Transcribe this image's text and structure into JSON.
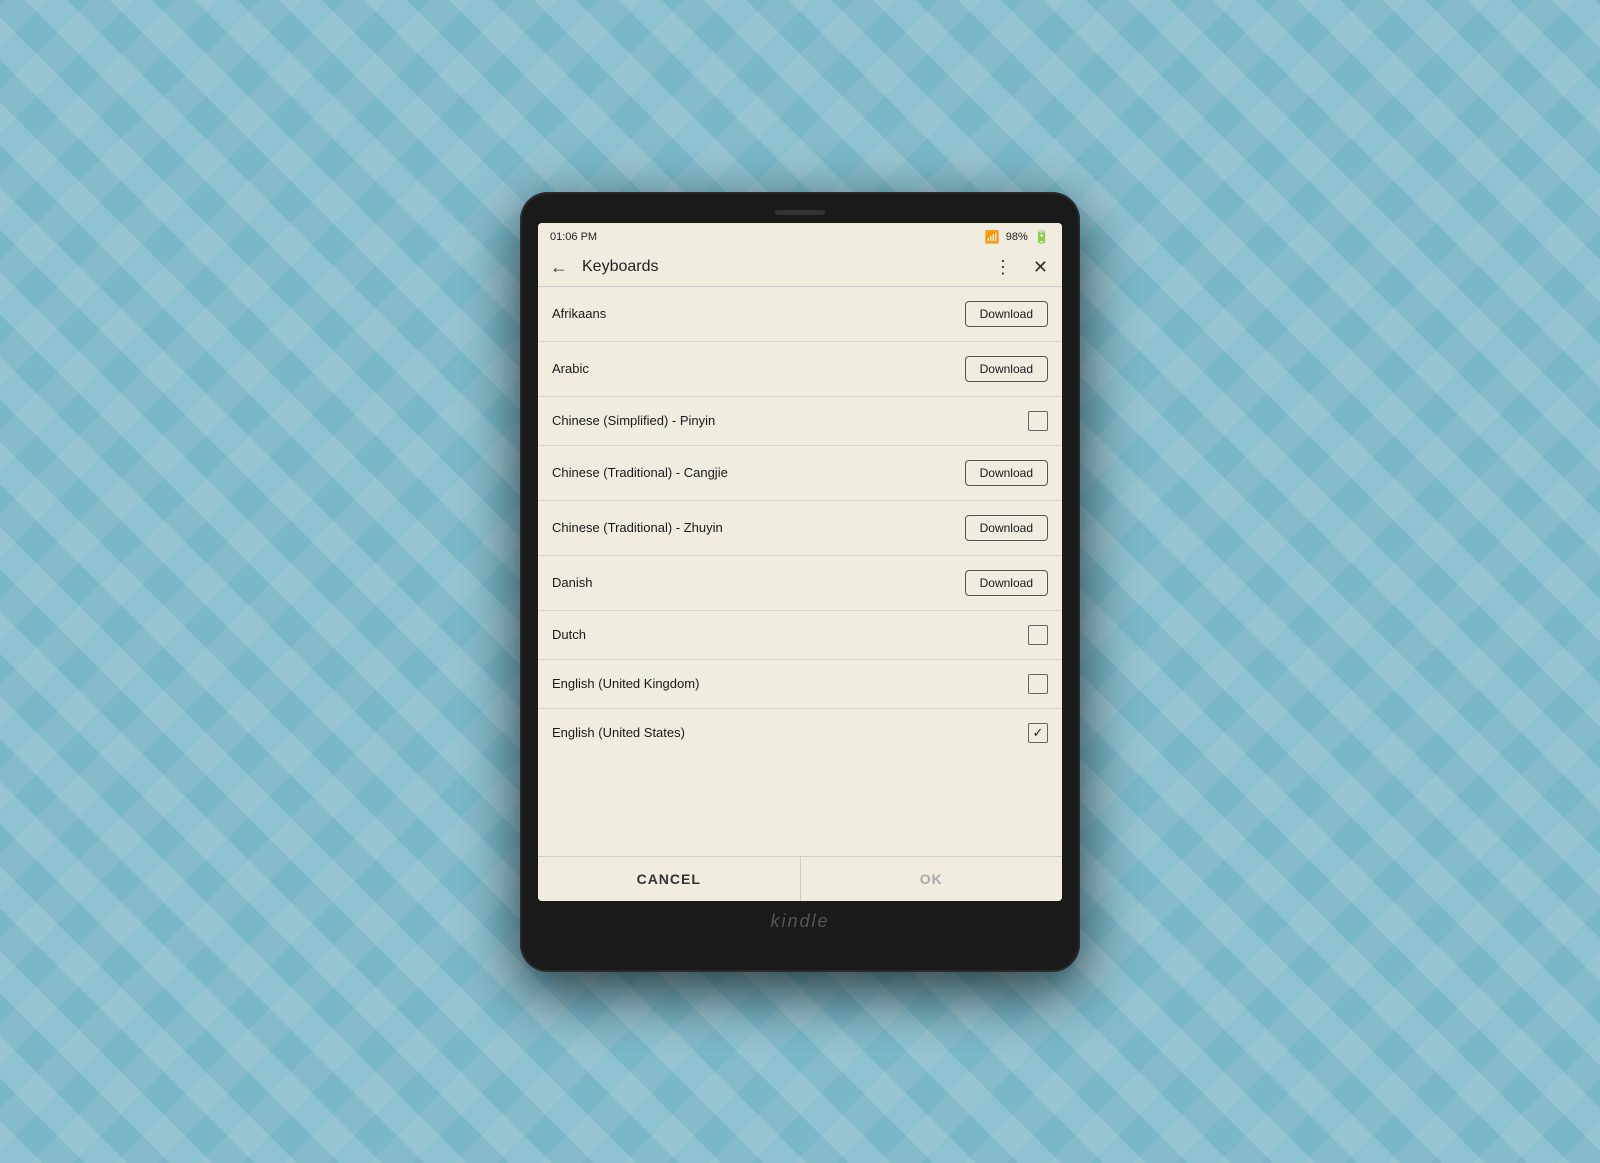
{
  "device": {
    "brand": "kindle"
  },
  "statusBar": {
    "time": "01:06 PM",
    "battery": "98%",
    "wifi": "WiFi"
  },
  "titleBar": {
    "title": "Keyboards",
    "backLabel": "←",
    "menuLabel": "⋮",
    "closeLabel": "✕"
  },
  "keyboardItems": [
    {
      "id": "afrikaans",
      "name": "Afrikaans",
      "control": "download",
      "checked": false
    },
    {
      "id": "arabic",
      "name": "Arabic",
      "control": "download",
      "checked": false
    },
    {
      "id": "chinese-simplified",
      "name": "Chinese (Simplified) - Pinyin",
      "control": "checkbox",
      "checked": false
    },
    {
      "id": "chinese-traditional-cangjie",
      "name": "Chinese (Traditional) - Cangjie",
      "control": "download",
      "checked": false
    },
    {
      "id": "chinese-traditional-zhuyin",
      "name": "Chinese (Traditional) - Zhuyin",
      "control": "download",
      "checked": false
    },
    {
      "id": "danish",
      "name": "Danish",
      "control": "download",
      "checked": false
    },
    {
      "id": "dutch",
      "name": "Dutch",
      "control": "checkbox",
      "checked": false
    },
    {
      "id": "english-uk",
      "name": "English (United Kingdom)",
      "control": "checkbox",
      "checked": false
    },
    {
      "id": "english-us",
      "name": "English (United States)",
      "control": "checkbox",
      "checked": true
    }
  ],
  "actions": {
    "cancelLabel": "CANCEL",
    "okLabel": "OK"
  },
  "buttons": {
    "downloadLabel": "Download"
  }
}
